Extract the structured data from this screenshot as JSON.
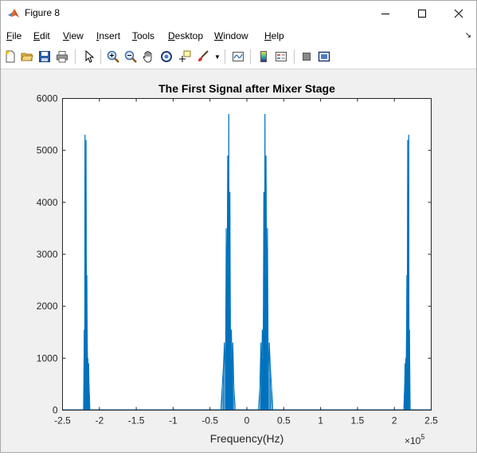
{
  "window": {
    "title": "Figure 8",
    "minimize_icon": "minimize-icon",
    "maximize_icon": "maximize-icon",
    "close_icon": "close-icon"
  },
  "menu": {
    "items": [
      "File",
      "Edit",
      "View",
      "Insert",
      "Tools",
      "Desktop",
      "Window",
      "Help"
    ]
  },
  "toolbar": {
    "icons": [
      "new-figure-icon",
      "open-file-icon",
      "save-icon",
      "print-icon",
      "pointer-icon",
      "zoom-in-icon",
      "zoom-out-icon",
      "pan-icon",
      "rotate-3d-icon",
      "data-cursor-icon",
      "brush-icon",
      "link-plot-icon",
      "colorbar-icon",
      "legend-icon",
      "hide-plot-tools-icon",
      "show-plot-tools-icon"
    ]
  },
  "colors": {
    "line": "#0072BD",
    "axes_bg": "#ffffff",
    "figure_bg": "#f0f0f0"
  },
  "chart_data": {
    "type": "line",
    "title": "The First Signal after Mixer Stage",
    "xlabel": "Frequency(Hz)",
    "ylabel": "",
    "x_exponent_label": "×10",
    "x_exponent_power": "5",
    "xlim": [
      -2.5,
      2.5
    ],
    "ylim": [
      0,
      6000
    ],
    "x_ticks": [
      "-2.5",
      "-2",
      "-1.5",
      "-1",
      "-0.5",
      "0",
      "0.5",
      "1",
      "1.5",
      "2",
      "2.5"
    ],
    "y_ticks": [
      "0",
      "1000",
      "2000",
      "3000",
      "4000",
      "5000",
      "6000"
    ],
    "grid": false,
    "series": [
      {
        "peaks": [
          {
            "x": [
              -2.215,
              -2.205,
              -2.2,
              -2.195,
              -2.19,
              -2.185,
              -2.18,
              -2.175,
              -2.17,
              -2.165,
              -2.16,
              -2.155,
              -2.15,
              -2.145,
              -2.14,
              -2.135,
              -2.13
            ],
            "y": [
              80,
              1550,
              900,
              5300,
              2400,
              3100,
              5200,
              2000,
              2600,
              1600,
              850,
              1000,
              700,
              900,
              500,
              300,
              80
            ]
          },
          {
            "x": [
              -0.35,
              -0.335,
              -0.32,
              -0.305,
              -0.29,
              -0.28,
              -0.27,
              -0.26,
              -0.25,
              -0.245,
              -0.24,
              -0.23,
              -0.22,
              -0.21,
              -0.2,
              -0.19,
              -0.175,
              -0.16
            ],
            "y": [
              80,
              450,
              800,
              1300,
              700,
              3500,
              2000,
              4900,
              2600,
              5700,
              2000,
              4200,
              1000,
              1550,
              700,
              1300,
              400,
              80
            ]
          },
          {
            "x": [
              0.16,
              0.175,
              0.19,
              0.2,
              0.21,
              0.22,
              0.23,
              0.24,
              0.245,
              0.25,
              0.26,
              0.27,
              0.28,
              0.29,
              0.305,
              0.32,
              0.335,
              0.35
            ],
            "y": [
              80,
              400,
              1300,
              700,
              1550,
              1000,
              4200,
              2000,
              5700,
              2600,
              4900,
              2000,
              3500,
              700,
              1300,
              800,
              450,
              80
            ]
          },
          {
            "x": [
              2.13,
              2.135,
              2.14,
              2.145,
              2.15,
              2.155,
              2.16,
              2.165,
              2.17,
              2.175,
              2.18,
              2.185,
              2.19,
              2.195,
              2.2,
              2.205,
              2.215
            ],
            "y": [
              80,
              300,
              500,
              900,
              700,
              1000,
              850,
              1600,
              2600,
              2000,
              5200,
              3100,
              2400,
              5300,
              900,
              1550,
              80
            ]
          }
        ]
      }
    ]
  }
}
